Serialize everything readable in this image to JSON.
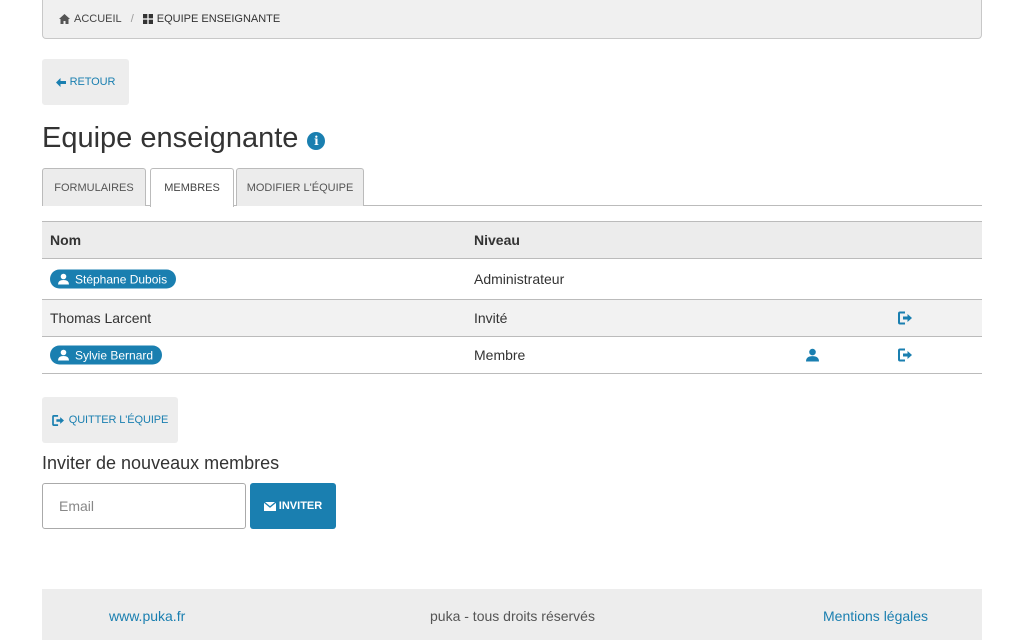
{
  "breadcrumb": {
    "home": "Accueil",
    "current": "Equipe enseignante"
  },
  "back_button": "Retour",
  "page_title": "Equipe enseignante",
  "tabs": [
    {
      "label": "Formulaires"
    },
    {
      "label": "Membres"
    },
    {
      "label": "Modifier l'équipe"
    }
  ],
  "active_tab": "Membres",
  "table": {
    "headers": {
      "name": "Nom",
      "level": "Niveau"
    },
    "rows": [
      {
        "name": "Stéphane Dubois",
        "level": "Administrateur",
        "badge": true
      },
      {
        "name": "Thomas Larcent",
        "level": "Invité",
        "badge": false
      },
      {
        "name": "Sylvie Bernard",
        "level": "Membre",
        "badge": true
      }
    ]
  },
  "quit_button": "Quitter l'équipe",
  "invite": {
    "heading": "Inviter de nouveaux membres",
    "placeholder": "Email",
    "button": "Inviter"
  },
  "footer": {
    "site": "www.puka.fr",
    "copyright": "puka - tous droits réservés",
    "legal": "Mentions légales"
  },
  "colors": {
    "accent": "#1a7fb0",
    "panel": "#ededed",
    "border": "#bbbbbb"
  },
  "icons": {
    "home": "home-icon",
    "grid": "grid-icon",
    "back": "arrow-left-icon",
    "info": "info-icon",
    "user": "user-icon",
    "logout": "logout-icon",
    "envelope": "envelope-icon"
  }
}
